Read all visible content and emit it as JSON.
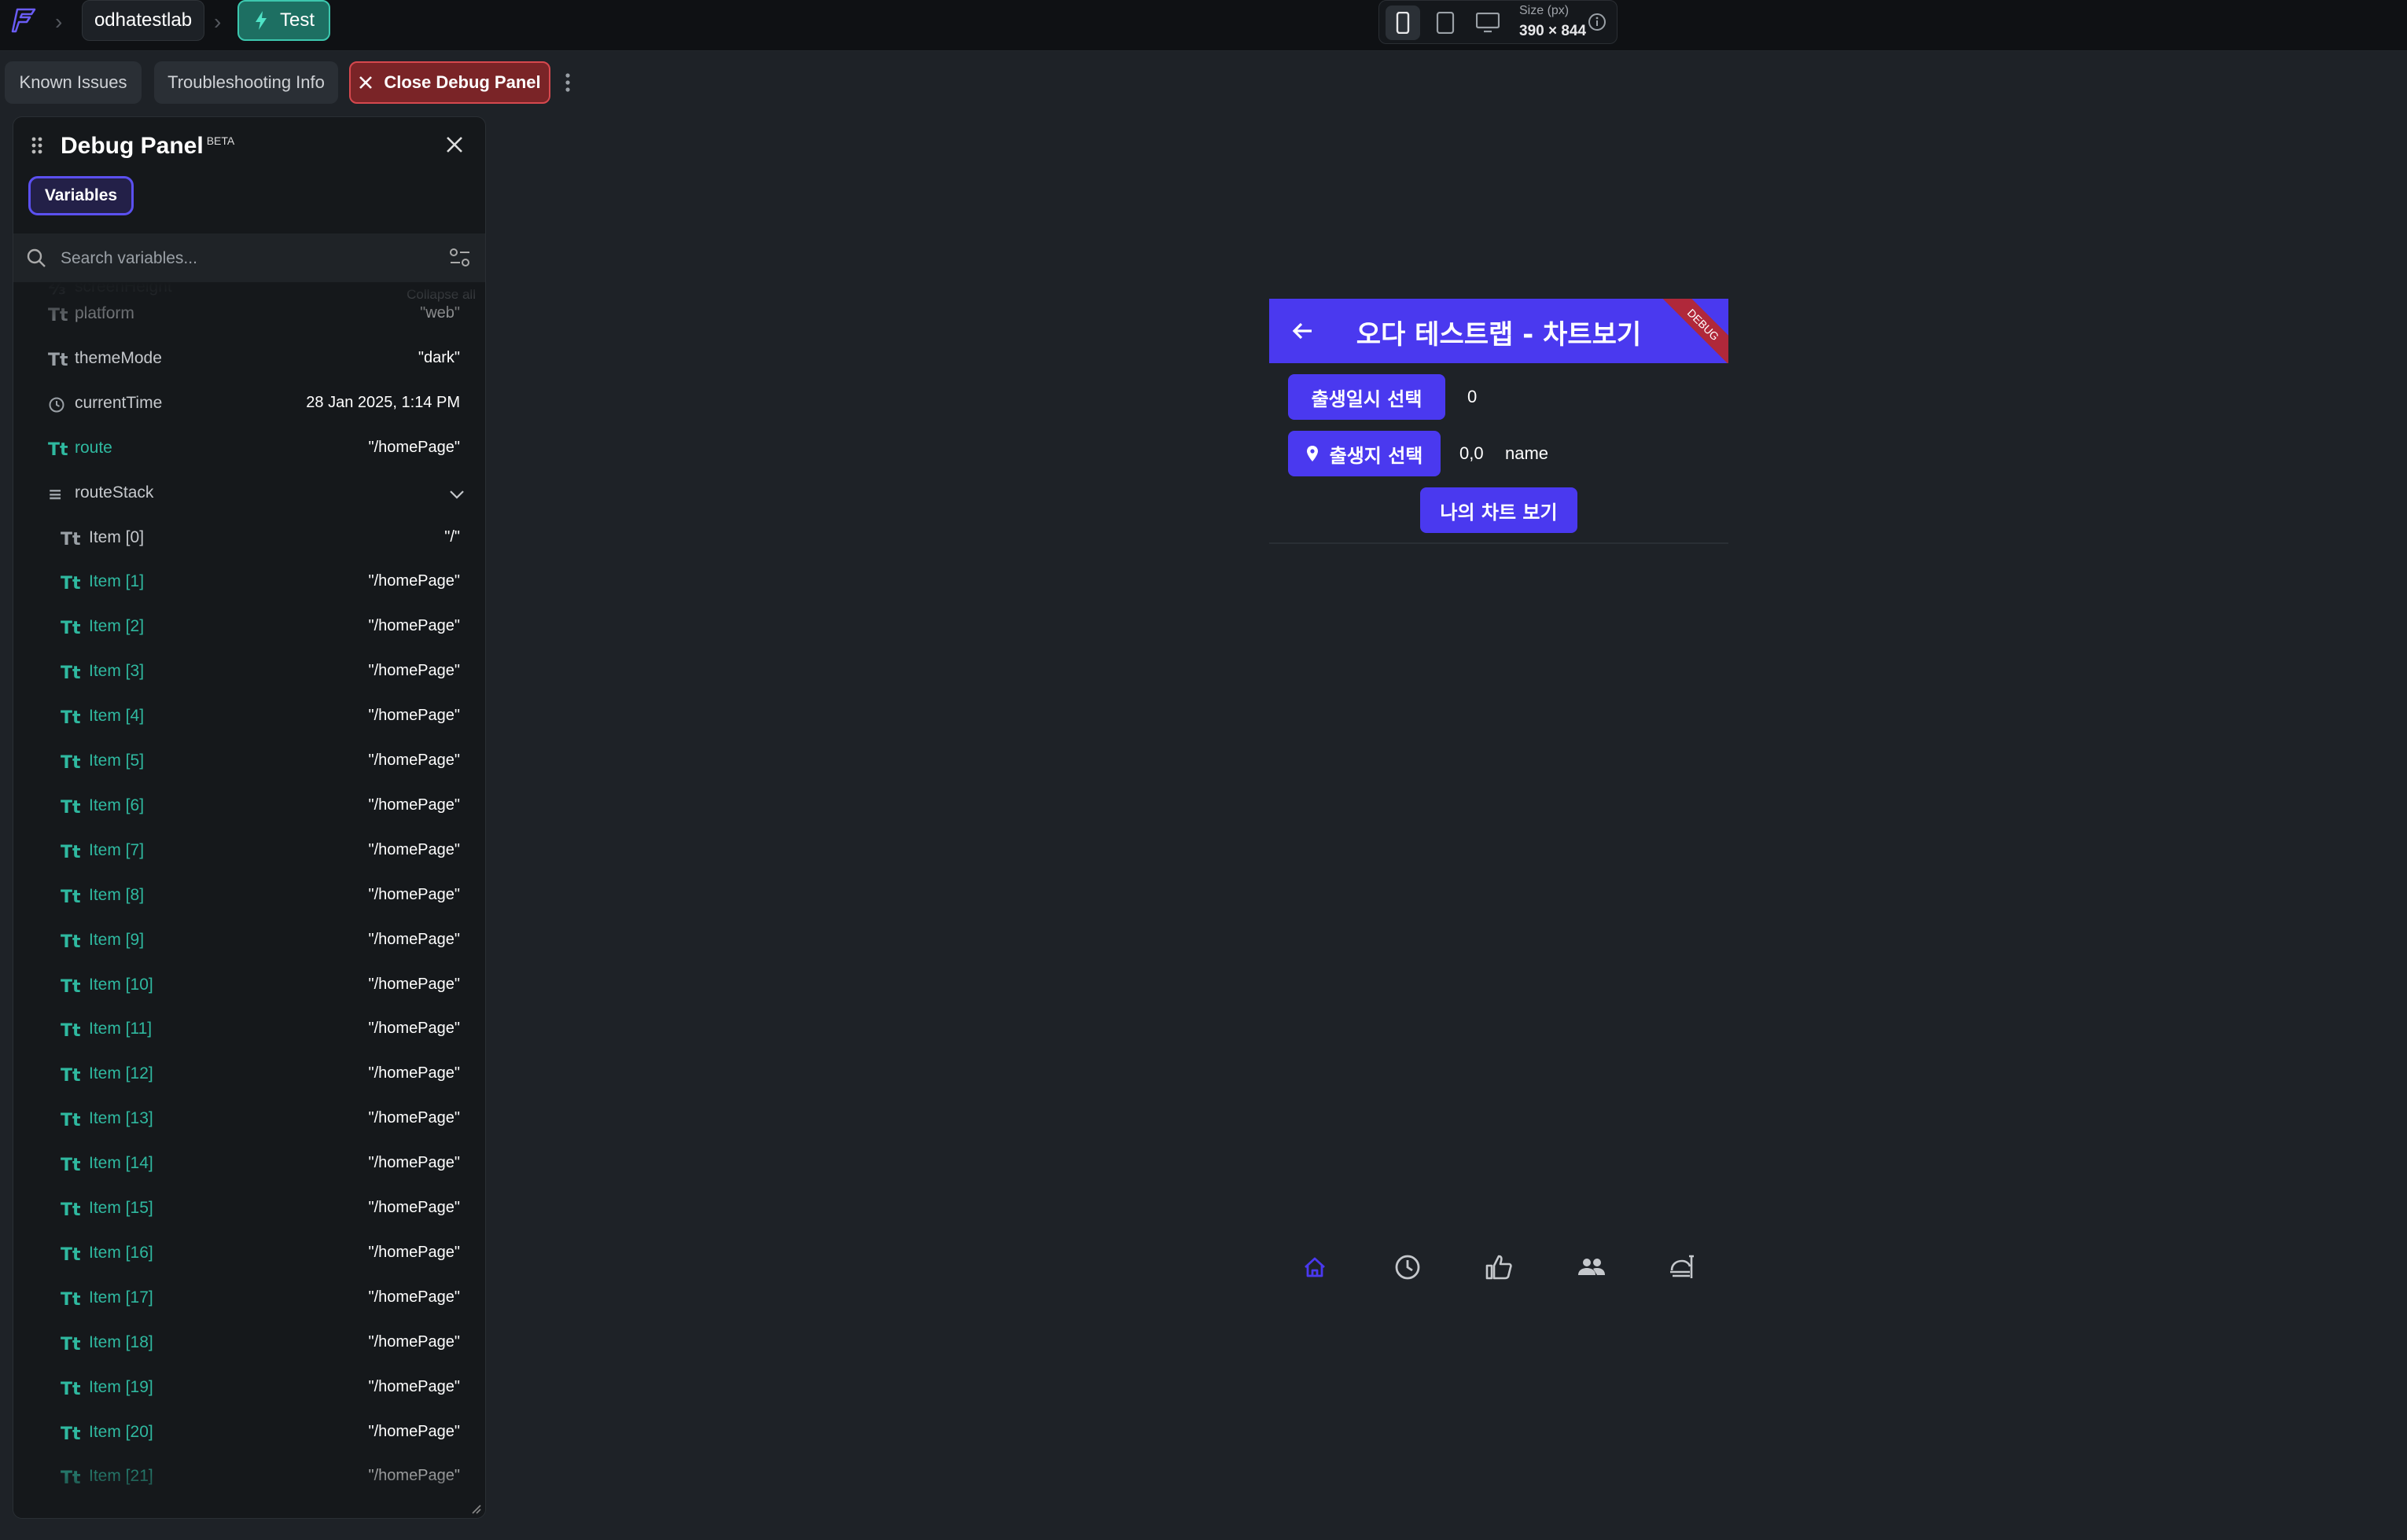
{
  "topbar": {
    "project": "odhatestlab",
    "mode": "Test",
    "size_label": "Size (px)",
    "size_value": "390 × 844"
  },
  "actions": {
    "known_issues": "Known Issues",
    "troubleshooting": "Troubleshooting Info",
    "close_debug": "Close Debug Panel"
  },
  "panel": {
    "title": "Debug Panel",
    "badge": "BETA",
    "tab": "Variables",
    "search_placeholder": "Search variables...",
    "collapse_all": "Collapse all",
    "partial_top": "screenHeight",
    "variables": [
      {
        "icon": "Tt",
        "name": "platform",
        "value": "\"web\""
      },
      {
        "icon": "Tt",
        "name": "themeMode",
        "value": "\"dark\""
      },
      {
        "icon": "clock",
        "name": "currentTime",
        "value": "28 Jan 2025, 1:14 PM"
      },
      {
        "icon": "Tt",
        "name": "route",
        "value": "\"/homePage\"",
        "accent": true
      },
      {
        "icon": "list",
        "name": "routeStack",
        "value": "",
        "expanded": true
      },
      {
        "icon": "Tt",
        "name": "Item [0]",
        "value": "\"/\"",
        "nested": true
      },
      {
        "icon": "Tt",
        "name": "Item [1]",
        "value": "\"/homePage\"",
        "nested": true,
        "accent": true
      },
      {
        "icon": "Tt",
        "name": "Item [2]",
        "value": "\"/homePage\"",
        "nested": true,
        "accent": true
      },
      {
        "icon": "Tt",
        "name": "Item [3]",
        "value": "\"/homePage\"",
        "nested": true,
        "accent": true
      },
      {
        "icon": "Tt",
        "name": "Item [4]",
        "value": "\"/homePage\"",
        "nested": true,
        "accent": true
      },
      {
        "icon": "Tt",
        "name": "Item [5]",
        "value": "\"/homePage\"",
        "nested": true,
        "accent": true
      },
      {
        "icon": "Tt",
        "name": "Item [6]",
        "value": "\"/homePage\"",
        "nested": true,
        "accent": true
      },
      {
        "icon": "Tt",
        "name": "Item [7]",
        "value": "\"/homePage\"",
        "nested": true,
        "accent": true
      },
      {
        "icon": "Tt",
        "name": "Item [8]",
        "value": "\"/homePage\"",
        "nested": true,
        "accent": true
      },
      {
        "icon": "Tt",
        "name": "Item [9]",
        "value": "\"/homePage\"",
        "nested": true,
        "accent": true
      },
      {
        "icon": "Tt",
        "name": "Item [10]",
        "value": "\"/homePage\"",
        "nested": true,
        "accent": true
      },
      {
        "icon": "Tt",
        "name": "Item [11]",
        "value": "\"/homePage\"",
        "nested": true,
        "accent": true
      },
      {
        "icon": "Tt",
        "name": "Item [12]",
        "value": "\"/homePage\"",
        "nested": true,
        "accent": true
      },
      {
        "icon": "Tt",
        "name": "Item [13]",
        "value": "\"/homePage\"",
        "nested": true,
        "accent": true
      },
      {
        "icon": "Tt",
        "name": "Item [14]",
        "value": "\"/homePage\"",
        "nested": true,
        "accent": true
      },
      {
        "icon": "Tt",
        "name": "Item [15]",
        "value": "\"/homePage\"",
        "nested": true,
        "accent": true
      },
      {
        "icon": "Tt",
        "name": "Item [16]",
        "value": "\"/homePage\"",
        "nested": true,
        "accent": true
      },
      {
        "icon": "Tt",
        "name": "Item [17]",
        "value": "\"/homePage\"",
        "nested": true,
        "accent": true
      },
      {
        "icon": "Tt",
        "name": "Item [18]",
        "value": "\"/homePage\"",
        "nested": true,
        "accent": true
      },
      {
        "icon": "Tt",
        "name": "Item [19]",
        "value": "\"/homePage\"",
        "nested": true,
        "accent": true
      },
      {
        "icon": "Tt",
        "name": "Item [20]",
        "value": "\"/homePage\"",
        "nested": true,
        "accent": true
      },
      {
        "icon": "Tt",
        "name": "Item [21]",
        "value": "\"/homePage\"",
        "nested": true,
        "accent": true
      }
    ]
  },
  "app": {
    "title": "오다 테스트랩 - 차트보기",
    "debug_banner": "DEBUG",
    "birth_button": "출생일시 선택",
    "birth_value": "0",
    "place_button": "출생지 선택",
    "place_coords": "0,0",
    "place_name": "name",
    "chart_button": "나의 차트 보기",
    "nav": [
      "home-icon",
      "clock-icon",
      "thumbs-up-icon",
      "people-icon",
      "room-service-icon"
    ],
    "accent": "#4a39ef"
  }
}
